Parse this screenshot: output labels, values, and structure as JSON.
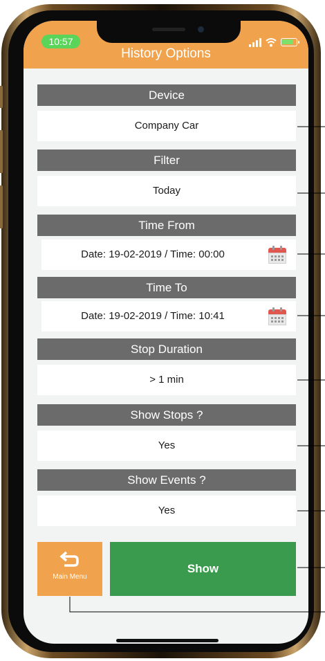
{
  "status_bar": {
    "time": "10:57"
  },
  "header": {
    "title": "History Options"
  },
  "sections": [
    {
      "header": "Device",
      "value": "Company Car"
    },
    {
      "header": "Filter",
      "value": "Today"
    },
    {
      "header": "Time From",
      "value": "Date: 19-02-2019 / Time: 00:00"
    },
    {
      "header": "Time To",
      "value": "Date: 19-02-2019 / Time: 10:41"
    },
    {
      "header": "Stop Duration",
      "value": "> 1 min"
    },
    {
      "header": "Show Stops ?",
      "value": "Yes"
    },
    {
      "header": "Show Events ?",
      "value": "Yes"
    }
  ],
  "buttons": {
    "main_menu": "Main Menu",
    "show": "Show"
  },
  "colors": {
    "accent": "#f0a24c",
    "section_header": "#6b6b6b",
    "show_button": "#3a9a4e",
    "background": "#f2f3f3"
  },
  "icons": [
    "signal-icon",
    "wifi-icon",
    "battery-icon",
    "calendar-icon",
    "back-arrow-icon"
  ]
}
